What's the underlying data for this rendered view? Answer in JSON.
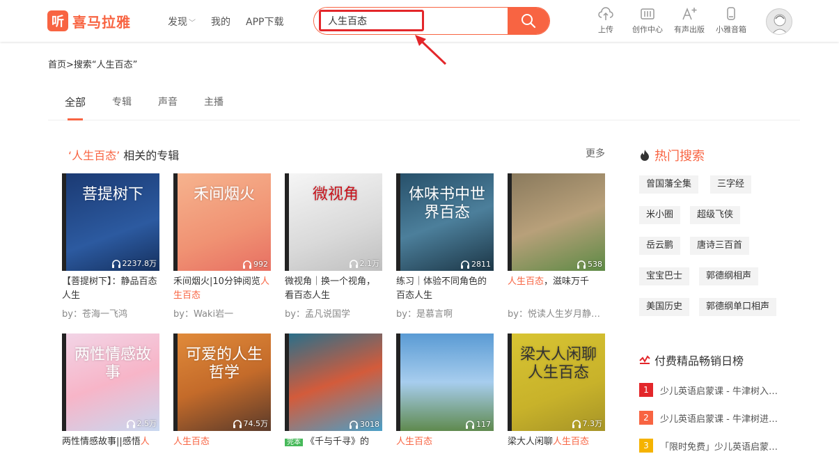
{
  "header": {
    "logo_mark": "听",
    "logo_text": "喜马拉雅",
    "nav": [
      "发现",
      "我的",
      "APP下载"
    ],
    "search_value": "人生百态",
    "icons": [
      {
        "label": "上传",
        "icon": "upload-cloud-icon"
      },
      {
        "label": "创作中心",
        "icon": "mixer-icon"
      },
      {
        "label": "有声出版",
        "icon": "font-plus-icon"
      },
      {
        "label": "小雅音箱",
        "icon": "speaker-icon"
      }
    ]
  },
  "breadcrumb": "首页>搜索“人生百态”",
  "tabs": [
    "全部",
    "专辑",
    "声音",
    "主播"
  ],
  "section": {
    "kw": "‘人生百态’",
    "suffix": "相关的专辑",
    "more": "更多"
  },
  "albums": [
    {
      "cover_text": "菩提树下",
      "plays": "2237.8万",
      "title_a": "【菩提树下】：静品百态人生",
      "title_red": "",
      "title_b": "",
      "by": "by：苍海一飞鸿"
    },
    {
      "cover_text": "禾间烟火",
      "plays": "992",
      "title_a": "禾间烟火|10分钟阅览",
      "title_red": "人生百态",
      "title_b": "",
      "by": "by：Waki岩一"
    },
    {
      "cover_text": "微视角",
      "plays": "2.1万",
      "title_a": "微视角｜换一个视角，看百态人生",
      "title_red": "",
      "title_b": "",
      "by": "by：孟凡说国学"
    },
    {
      "cover_text": "体味书中世界百态",
      "plays": "2811",
      "title_a": "练习｜体验不同角色的百态人生",
      "title_red": "",
      "title_b": "",
      "by": "by：是慕言啊"
    },
    {
      "cover_text": "",
      "plays": "538",
      "title_a": "",
      "title_red": "人生百态",
      "title_b": "，滋味万千",
      "by": "by：悦读人生岁月静…"
    },
    {
      "cover_text": "两性情感故事",
      "plays": "2.5万",
      "title_a": "两性情感故事||感悟",
      "title_red": "人",
      "title_b": "",
      "by": ""
    },
    {
      "cover_text": "可爱的人生哲学",
      "plays": "74.5万",
      "title_a": "",
      "title_red": "人生百态",
      "title_b": "",
      "by": ""
    },
    {
      "cover_text": "",
      "plays": "3018",
      "badge": "完本",
      "title_a": "《千与千寻》的",
      "title_red": "",
      "title_b": "",
      "by": ""
    },
    {
      "cover_text": "",
      "plays": "117",
      "title_a": "",
      "title_red": "人生百态",
      "title_b": "",
      "by": ""
    },
    {
      "cover_text": "梁大人闲聊人生百态",
      "plays": "7.3万",
      "title_a": "梁大人闲聊",
      "title_red": "人生百态",
      "title_b": "",
      "by": ""
    }
  ],
  "hot": {
    "title": "热门搜索",
    "tags": [
      "曾国藩全集",
      "三字经",
      "米小圈",
      "超级飞侠",
      "岳云鹏",
      "唐诗三百首",
      "宝宝巴士",
      "郭德纲相声",
      "美国历史",
      "郭德纲单口相声"
    ]
  },
  "rank": {
    "title": "付费精品畅销日榜",
    "items": [
      {
        "num": "1",
        "text": "少儿英语启蒙课 - 牛津树入…",
        "color": "#e3262a"
      },
      {
        "num": "2",
        "text": "少儿英语启蒙课 - 牛津树进…",
        "color": "#f86442"
      },
      {
        "num": "3",
        "text": "「限时免费」少儿英语启蒙…",
        "color": "#f5b300"
      }
    ]
  },
  "colors": {
    "accent": "#f86442",
    "highlight": "#e3262a"
  }
}
